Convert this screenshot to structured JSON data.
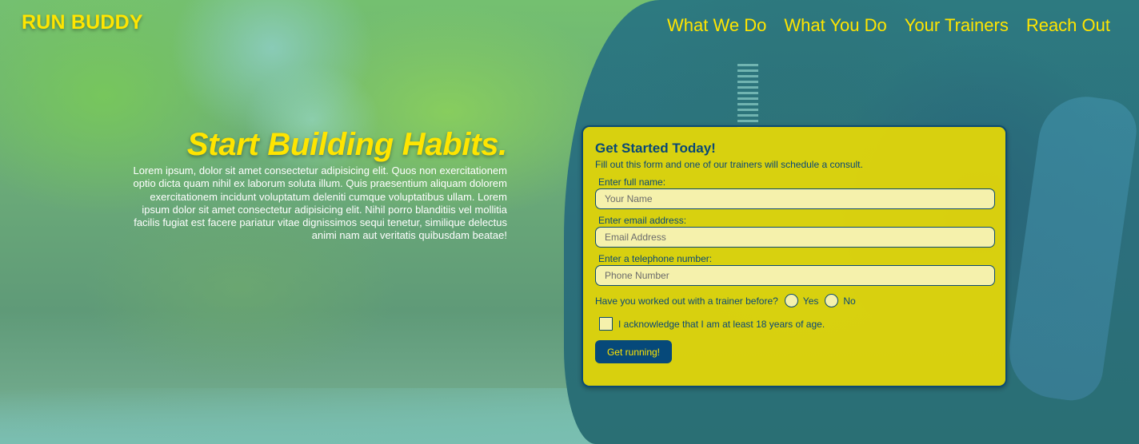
{
  "header": {
    "logo": "RUN BUDDY",
    "nav": [
      "What We Do",
      "What You Do",
      "Your Trainers",
      "Reach Out"
    ]
  },
  "hero": {
    "title": "Start Building Habits.",
    "body": "Lorem ipsum, dolor sit amet consectetur adipisicing elit. Quos non exercitationem optio dicta quam nihil ex laborum soluta illum. Quis praesentium aliquam dolorem exercitationem incidunt voluptatum deleniti cumque voluptatibus ullam. Lorem ipsum dolor sit amet consectetur adipisicing elit. Nihil porro blanditiis vel mollitia facilis fugiat est facere pariatur vitae dignissimos sequi tenetur, similique delectus animi nam aut veritatis quibusdam beatae!"
  },
  "form": {
    "title": "Get Started Today!",
    "subtitle": "Fill out this form and one of our trainers will schedule a consult.",
    "name_label": "Enter full name:",
    "name_placeholder": "Your Name",
    "name_value": "",
    "email_label": "Enter email address:",
    "email_placeholder": "Email Address",
    "email_value": "",
    "phone_label": "Enter a telephone number:",
    "phone_placeholder": "Phone Number",
    "phone_value": "",
    "trainer_question": "Have you worked out with a trainer before?",
    "radio_yes": "Yes",
    "radio_no": "No",
    "age_ack": "I acknowledge that I am at least 18 years of age.",
    "submit_label": "Get running!"
  },
  "colors": {
    "accent_yellow": "#ffe500",
    "navy": "#06497a"
  }
}
